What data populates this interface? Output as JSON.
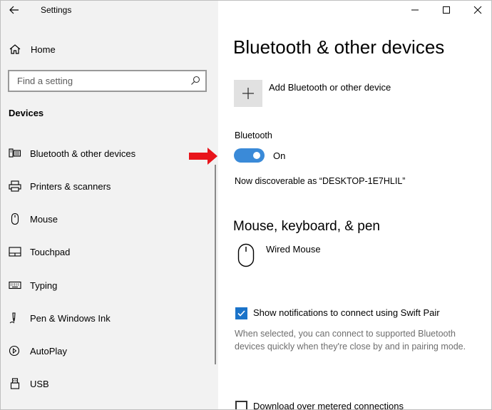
{
  "window": {
    "app_title": "Settings"
  },
  "sidebar": {
    "home_label": "Home",
    "search_placeholder": "Find a setting",
    "section_heading": "Devices",
    "items": [
      {
        "label": "Bluetooth & other devices",
        "icon": "bluetooth-devices-icon"
      },
      {
        "label": "Printers & scanners",
        "icon": "printer-icon"
      },
      {
        "label": "Mouse",
        "icon": "mouse-icon"
      },
      {
        "label": "Touchpad",
        "icon": "touchpad-icon"
      },
      {
        "label": "Typing",
        "icon": "keyboard-icon"
      },
      {
        "label": "Pen & Windows Ink",
        "icon": "pen-icon"
      },
      {
        "label": "AutoPlay",
        "icon": "autoplay-icon"
      },
      {
        "label": "USB",
        "icon": "usb-icon"
      }
    ]
  },
  "main": {
    "title": "Bluetooth & other devices",
    "add_device_label": "Add Bluetooth or other device",
    "bluetooth": {
      "label": "Bluetooth",
      "state": "On",
      "enabled": true,
      "discoverable_text": "Now discoverable as “DESKTOP-1E7HLIL”"
    },
    "devices_heading": "Mouse, keyboard, & pen",
    "devices": [
      {
        "name": "Wired Mouse",
        "icon": "mouse-icon"
      }
    ],
    "swift_pair": {
      "label": "Show notifications to connect using Swift Pair",
      "checked": true,
      "description": "When selected, you can connect to supported Bluetooth devices quickly when they're close by and in pairing mode."
    },
    "metered": {
      "label": "Download over metered connections",
      "checked": false
    }
  },
  "colors": {
    "accent": "#1a73c9",
    "toggle_on": "#3a8ad8",
    "sidebar_bg": "#f2f2f2",
    "annotation_arrow": "#e8141b"
  }
}
